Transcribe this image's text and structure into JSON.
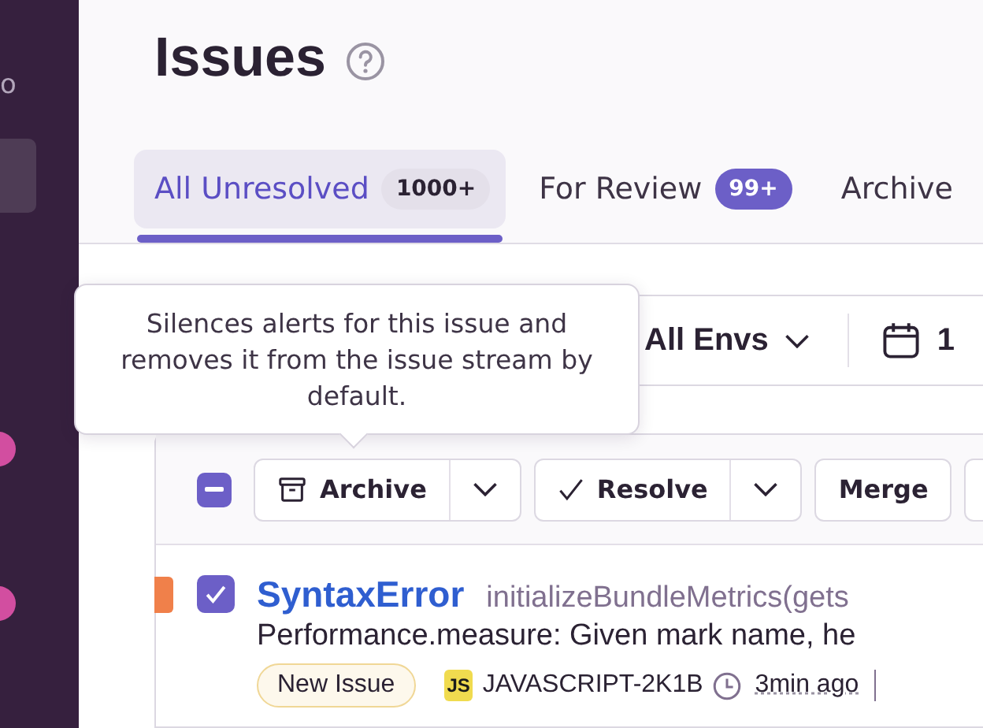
{
  "sidebar": {
    "label": "o"
  },
  "page": {
    "title": "Issues"
  },
  "tabs": [
    {
      "label": "All Unresolved",
      "count": "1000+",
      "count_highlighted": false,
      "selected": true
    },
    {
      "label": "For Review",
      "count": "99+",
      "count_highlighted": true,
      "selected": false
    },
    {
      "label": "Archive",
      "selected": false
    }
  ],
  "filters": {
    "environment": "All Envs",
    "date": "1"
  },
  "tooltip": "Silences alerts for this issue and removes it from the issue stream by default.",
  "bulk_actions": {
    "indeterminate": true,
    "buttons": [
      {
        "label": "Archive",
        "kind": "archive",
        "dropdown": true
      },
      {
        "label": "Resolve",
        "kind": "resolve",
        "dropdown": true
      },
      {
        "label": "Merge",
        "kind": "plain",
        "dropdown": false
      }
    ]
  },
  "issues": [
    {
      "color": "#f0804a",
      "checked": true,
      "title": "SyntaxError",
      "culprit": "initializeBundleMetrics(gets",
      "message": "Performance.measure: Given mark name, he",
      "badge": "New Issue",
      "platform": "JS",
      "project": "JAVASCRIPT-2K1B",
      "time": "3min ago"
    }
  ]
}
